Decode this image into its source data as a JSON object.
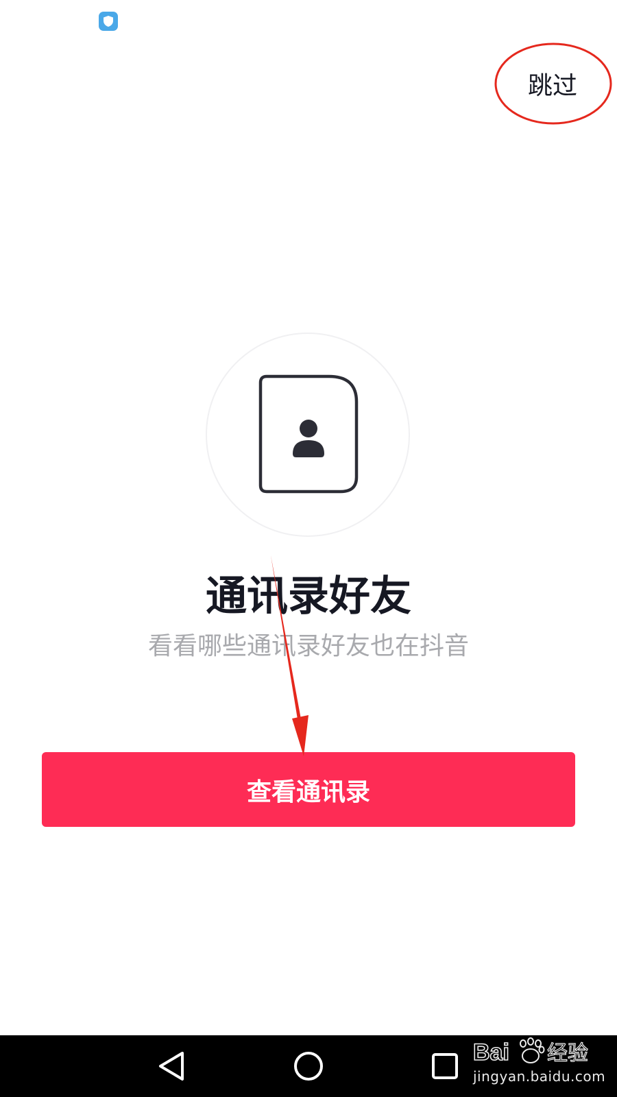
{
  "status_bar": {
    "icon": "shield-icon",
    "icon_color": "#4aa8e8"
  },
  "header": {
    "skip_label": "跳过"
  },
  "main": {
    "icon": "contact-card-icon",
    "title": "通讯录好友",
    "subtitle": "看看哪些通讯录好友也在抖音",
    "primary_button_label": "查看通讯录"
  },
  "nav_bar": {
    "items": [
      "back-icon",
      "home-icon",
      "recent-apps-icon"
    ]
  },
  "watermark": {
    "brand": "Baidu经验",
    "domain": "jingyan.baidu.com"
  },
  "colors": {
    "primary": "#fe2c55",
    "title_text": "#161823",
    "subtitle_text": "#a8a9ad",
    "annotation": "#e5281d"
  }
}
